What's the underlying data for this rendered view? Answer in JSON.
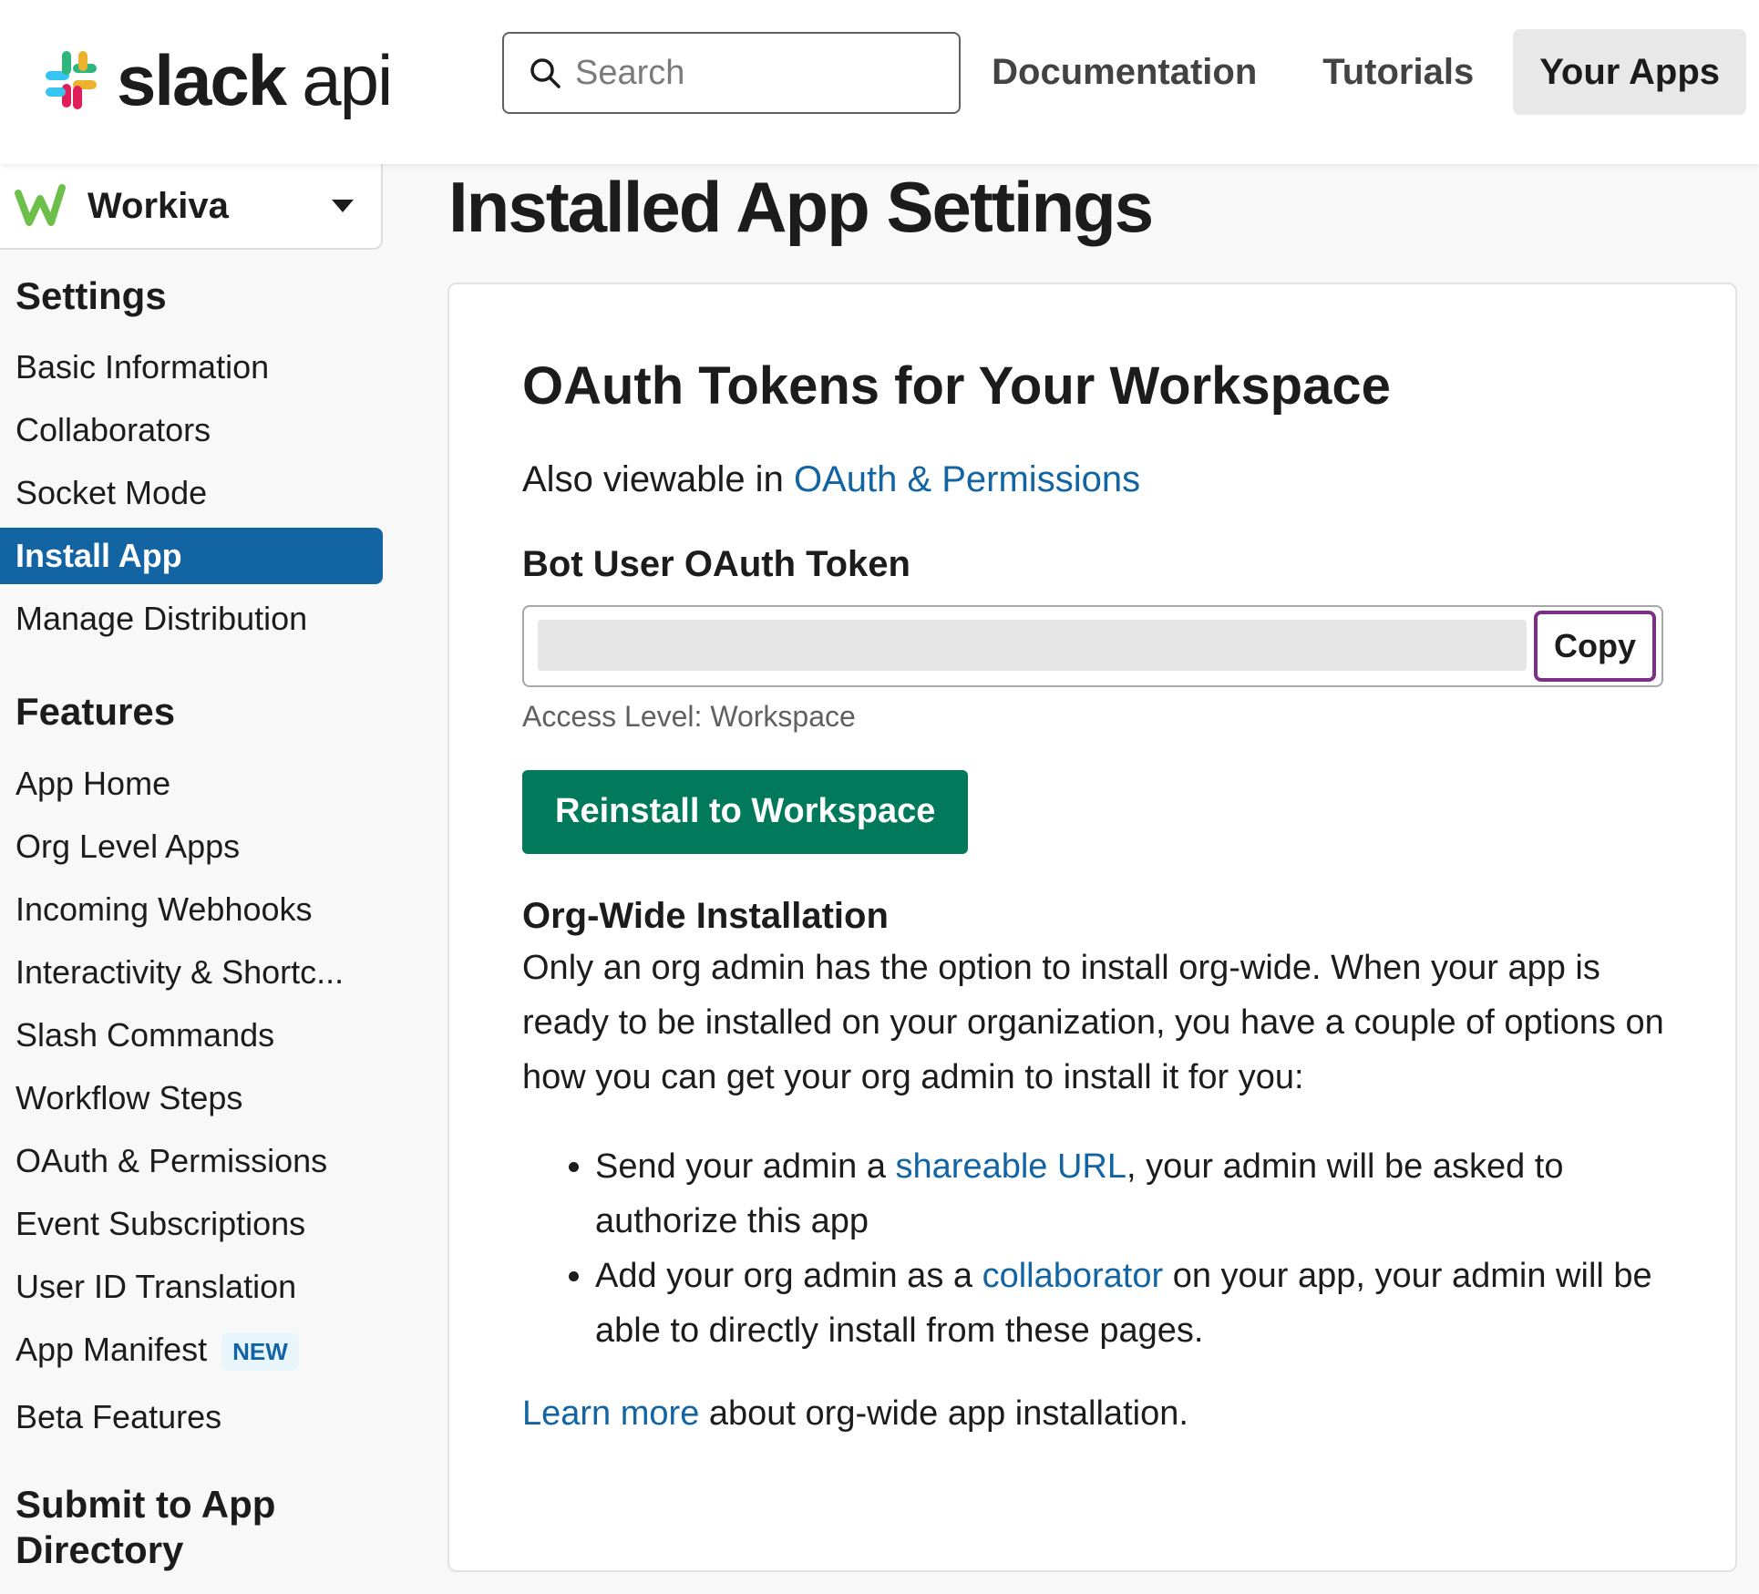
{
  "header": {
    "logo_slack": "slack",
    "logo_api": "api",
    "search_placeholder": "Search",
    "nav": [
      "Documentation",
      "Tutorials",
      "Your Apps"
    ],
    "active_nav": "Your Apps"
  },
  "workspace": {
    "name": "Workiva",
    "icon": "workiva-logo-icon"
  },
  "sidebar": {
    "settings_heading": "Settings",
    "settings_items": [
      "Basic Information",
      "Collaborators",
      "Socket Mode",
      "Install App",
      "Manage Distribution"
    ],
    "active_item": "Install App",
    "features_heading": "Features",
    "features_items": [
      "App Home",
      "Org Level Apps",
      "Incoming Webhooks",
      "Interactivity & Shortc...",
      "Slash Commands",
      "Workflow Steps",
      "OAuth & Permissions",
      "Event Subscriptions",
      "User ID Translation",
      "App Manifest",
      "Beta Features"
    ],
    "new_badge": "NEW",
    "submit_heading": "Submit to App Directory"
  },
  "main": {
    "page_title": "Installed App Settings",
    "card_title": "OAuth Tokens for Your Workspace",
    "viewable_prefix": "Also viewable in ",
    "viewable_link": "OAuth & Permissions",
    "token_label": "Bot User OAuth Token",
    "copy_label": "Copy",
    "access_level": "Access Level: Workspace",
    "reinstall_label": "Reinstall to Workspace",
    "org_heading": "Org-Wide Installation",
    "org_paragraph": "Only an org admin has the option to install org-wide. When your app is ready to be installed on your organization, you have a couple of options on how you can get your org admin to install it for you:",
    "option1_prefix": "Send your admin a ",
    "option1_link": "shareable URL",
    "option1_suffix": ", your admin will be asked to authorize this app",
    "option2_prefix": "Add your org admin as a ",
    "option2_link": "collaborator",
    "option2_suffix": " on your app, your admin will be able to directly install from these pages.",
    "learn_link": "Learn more",
    "learn_suffix": " about org-wide app installation."
  },
  "colors": {
    "link": "#1264a3",
    "active_sidebar": "#1264a3",
    "reinstall_button": "#007a5a",
    "copy_focus": "#7c3085"
  }
}
